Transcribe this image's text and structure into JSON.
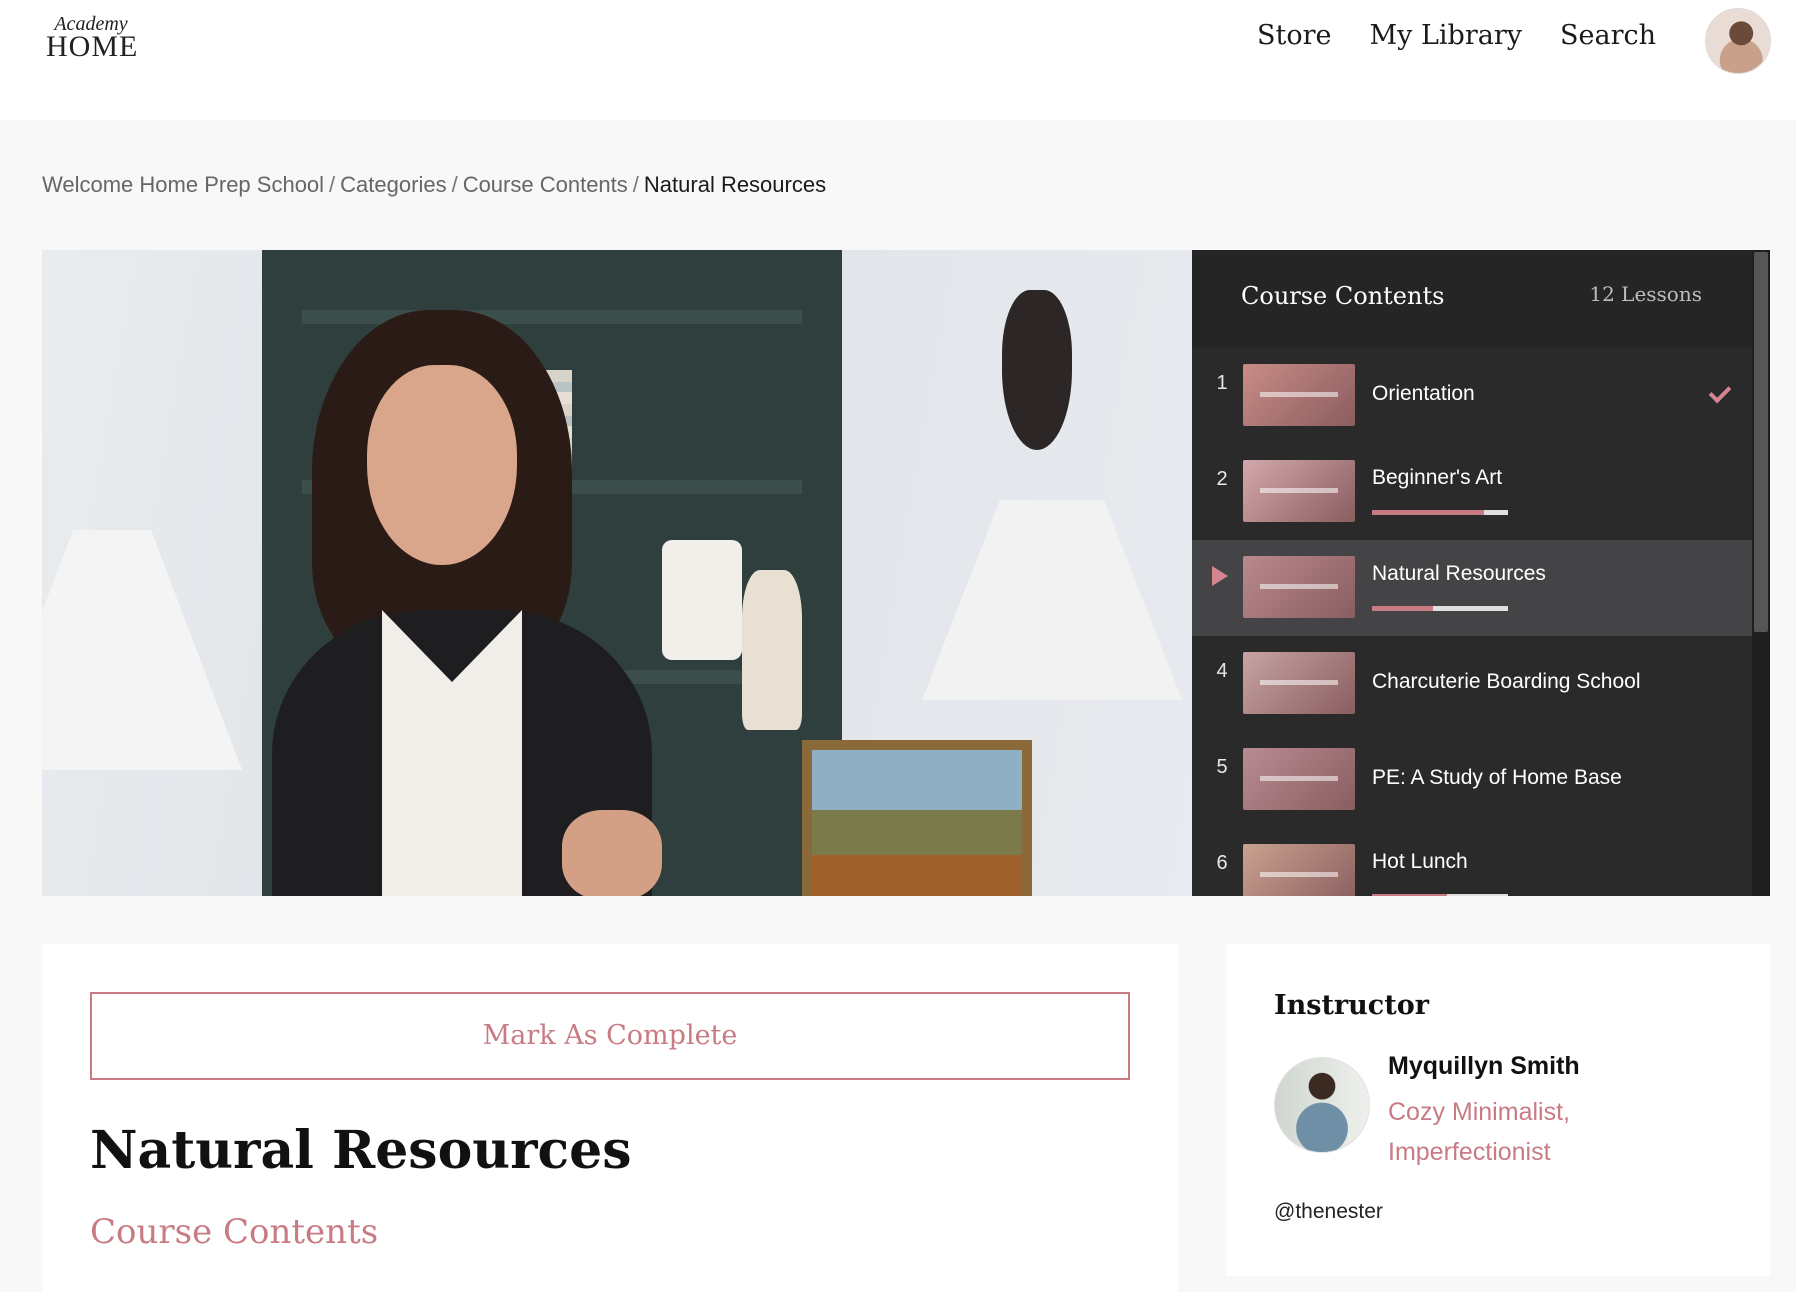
{
  "header": {
    "logo_top": "Academy",
    "logo_main": "HOME",
    "nav": [
      {
        "label": "Store"
      },
      {
        "label": "My Library"
      },
      {
        "label": "Search"
      }
    ]
  },
  "breadcrumb": {
    "items": [
      "Welcome Home Prep School",
      "Categories",
      "Course Contents"
    ],
    "separator": "/",
    "current": "Natural Resources"
  },
  "course_panel": {
    "title": "Course Contents",
    "count": "12 Lessons",
    "lessons": [
      {
        "number": "1",
        "title": "Orientation",
        "completed": true,
        "active": false,
        "progress": null,
        "thumb_color": "#c98c86"
      },
      {
        "number": "2",
        "title": "Beginner's Art",
        "completed": false,
        "active": false,
        "progress": 0.82,
        "thumb_color": "#d3a9ac"
      },
      {
        "number": "3",
        "title": "Natural Resources",
        "completed": false,
        "active": true,
        "progress": 0.45,
        "thumb_color": "#b98a8d"
      },
      {
        "number": "4",
        "title": "Charcuterie Boarding School",
        "completed": false,
        "active": false,
        "progress": null,
        "thumb_color": "#c7a4a3"
      },
      {
        "number": "5",
        "title": "PE: A Study of Home Base",
        "completed": false,
        "active": false,
        "progress": null,
        "thumb_color": "#b88c93"
      },
      {
        "number": "6",
        "title": "Hot Lunch",
        "completed": false,
        "active": false,
        "progress": 0.55,
        "thumb_color": "#c9a28f"
      }
    ]
  },
  "main": {
    "complete_button": "Mark As Complete",
    "title": "Natural Resources",
    "section_link": "Course Contents"
  },
  "instructor": {
    "heading": "Instructor",
    "name": "Myquillyn Smith",
    "tagline_line1": "Cozy Minimalist,",
    "tagline_line2": "Imperfectionist",
    "handle": "@thenester"
  },
  "colors": {
    "accent": "#c97b84",
    "panel_bg": "#2a2a2b",
    "active_row": "#444446"
  },
  "icons": [
    "play-icon",
    "check-icon",
    "user-avatar"
  ]
}
